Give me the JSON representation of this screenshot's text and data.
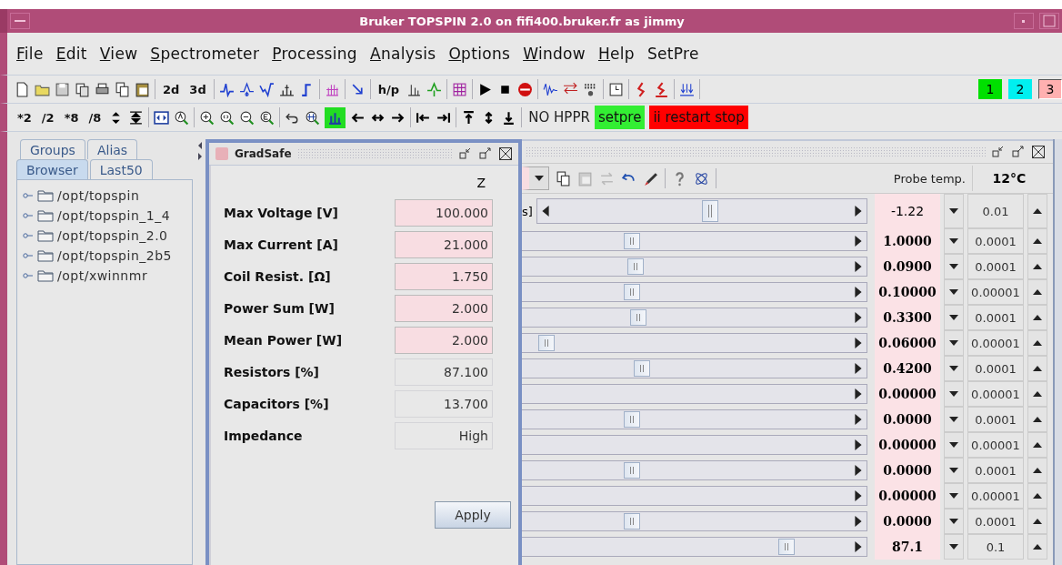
{
  "window": {
    "title": "Bruker TOPSPIN 2.0 on fifi400.bruker.fr as jimmy"
  },
  "menu": [
    {
      "label": "File",
      "mnemonic": true
    },
    {
      "label": "Edit",
      "mnemonic": true
    },
    {
      "label": "View",
      "mnemonic": true
    },
    {
      "label": "Spectrometer",
      "mnemonic": true
    },
    {
      "label": "Processing",
      "mnemonic": true
    },
    {
      "label": "Analysis",
      "mnemonic": true
    },
    {
      "label": "Options",
      "mnemonic": true
    },
    {
      "label": "Window",
      "mnemonic": true
    },
    {
      "label": "Help",
      "mnemonic": true
    },
    {
      "label": "SetPre",
      "mnemonic": false
    }
  ],
  "toolbar_1": {
    "dim_buttons": [
      "2d",
      "3d"
    ],
    "hp_button": "h/p",
    "window_buttons": [
      {
        "label": "1",
        "color": "#00e000",
        "selected": false
      },
      {
        "label": "2",
        "color": "#00f0f0",
        "selected": false
      },
      {
        "label": "3",
        "color": "#ffb0b0",
        "selected": true
      }
    ]
  },
  "toolbar_2": {
    "scale_buttons": [
      "*2",
      "/2",
      "*8",
      "/8"
    ],
    "bar_view": {
      "selected": true
    },
    "status_text": "NO HPPR",
    "status_buttons": [
      {
        "label": "setpre",
        "color": "#33ee33"
      },
      {
        "label": "ii restart  stop",
        "color": "#ff0000"
      }
    ]
  },
  "browser": {
    "tabs_back": [
      {
        "label": "Groups",
        "selected": false
      },
      {
        "label": "Alias",
        "selected": false
      }
    ],
    "tabs_front": [
      {
        "label": "Browser",
        "selected": true
      },
      {
        "label": "Last50",
        "selected": false
      }
    ],
    "items": [
      {
        "label": "/opt/topspin",
        "expanded": false
      },
      {
        "label": "/opt/topspin_1_4",
        "expanded": false
      },
      {
        "label": "/opt/topspin_2.0",
        "expanded": false
      },
      {
        "label": "/opt/topspin_2b5",
        "expanded": false
      },
      {
        "label": "/opt/xwinnmr",
        "expanded": false
      }
    ]
  },
  "dialog": {
    "title": "GradSafe",
    "column": "Z",
    "fields": [
      {
        "label": "Max Voltage [V]",
        "value": "100.000",
        "editable": true
      },
      {
        "label": "Max Current [A]",
        "value": "21.000",
        "editable": true
      },
      {
        "label": "Coil Resist. [Ω]",
        "value": "1.750",
        "editable": true
      },
      {
        "label": "Power Sum [W]",
        "value": "2.000",
        "editable": true
      },
      {
        "label": "Mean Power [W]",
        "value": "2.000",
        "editable": true
      },
      {
        "label": "Resistors [%]",
        "value": "87.100",
        "editable": false
      },
      {
        "label": "Capacitors [%]",
        "value": "13.700",
        "editable": false
      },
      {
        "label": "Impedance",
        "value": "High",
        "editable": false
      }
    ],
    "button": "Apply"
  },
  "shim": {
    "probe_label": "Probe temp.",
    "probe_value": "12°C",
    "rows": [
      {
        "label_fragment": "s]",
        "level": 0.5,
        "value": "-1.22",
        "bold": false,
        "step": "0.01"
      },
      {
        "level": 0.31,
        "value": "1.0000",
        "bold": true,
        "step": "0.0001"
      },
      {
        "level": 0.32,
        "value": "0.0900",
        "bold": true,
        "step": "0.0001"
      },
      {
        "level": 0.31,
        "value": "0.10000",
        "bold": true,
        "step": "0.00001"
      },
      {
        "level": 0.33,
        "value": "0.3300",
        "bold": true,
        "step": "0.0001"
      },
      {
        "level": 0.05,
        "value": "0.06000",
        "bold": true,
        "step": "0.00001"
      },
      {
        "level": 0.34,
        "value": "0.4200",
        "bold": true,
        "step": "0.0001"
      },
      {
        "value": "0.00000",
        "bold": true,
        "step": "0.00001"
      },
      {
        "level": 0.31,
        "value": "0.0000",
        "bold": true,
        "step": "0.0001"
      },
      {
        "value": "0.00000",
        "bold": true,
        "step": "0.00001"
      },
      {
        "level": 0.31,
        "value": "0.0000",
        "bold": true,
        "step": "0.0001"
      },
      {
        "value": "0.00000",
        "bold": true,
        "step": "0.00001"
      },
      {
        "level": 0.31,
        "value": "0.0000",
        "bold": true,
        "step": "0.0001"
      },
      {
        "level": 0.78,
        "value": "87.1",
        "bold": true,
        "step": "0.1"
      }
    ]
  }
}
